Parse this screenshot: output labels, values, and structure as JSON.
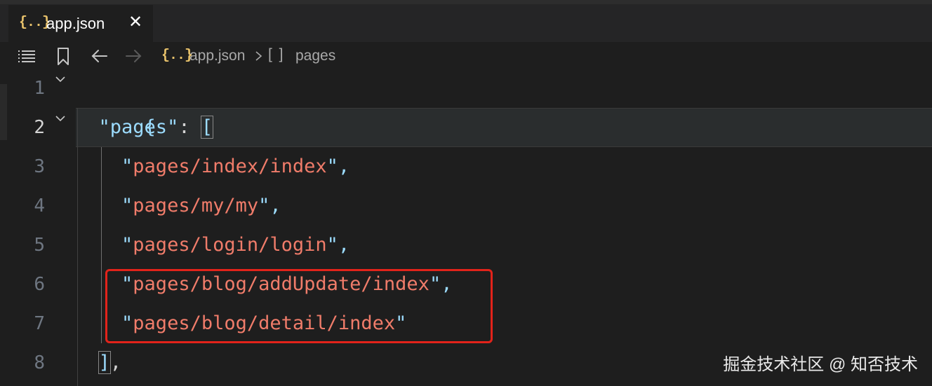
{
  "tab": {
    "icon": "{..}",
    "label": "app.json",
    "close": "✕"
  },
  "breadcrumb": {
    "file_icon": "{..}",
    "file": "app.json",
    "array_icon": "[ ]",
    "node": "pages"
  },
  "toolbar_icons": [
    "list-icon",
    "bookmark-icon",
    "arrow-left-icon",
    "arrow-right-icon"
  ],
  "lines": [
    {
      "number": "1",
      "open": "{"
    },
    {
      "number": "2",
      "q1": "\"",
      "key": "pages",
      "q2": "\"",
      "colon": ": ",
      "bracket": "["
    },
    {
      "number": "3",
      "q1": "\"",
      "text": "pages/index/index",
      "q2": "\"",
      "comma": ","
    },
    {
      "number": "4",
      "q1": "\"",
      "text": "pages/my/my",
      "q2": "\"",
      "comma": ","
    },
    {
      "number": "5",
      "q1": "\"",
      "text": "pages/login/login",
      "q2": "\"",
      "comma": ","
    },
    {
      "number": "6",
      "q1": "\"",
      "text": "pages/blog/addUpdate/index",
      "q2": "\"",
      "comma": ","
    },
    {
      "number": "7",
      "q1": "\"",
      "text": "pages/blog/detail/index",
      "q2": "\""
    },
    {
      "number": "8",
      "close": "]",
      "comma": ","
    }
  ],
  "watermark": "掘金技术社区 @ 知否技术",
  "colors": {
    "background": "#1e1e1e",
    "string": "#f07c6a",
    "key": "#9cdcfe",
    "highlight_box": "#e2231a"
  }
}
